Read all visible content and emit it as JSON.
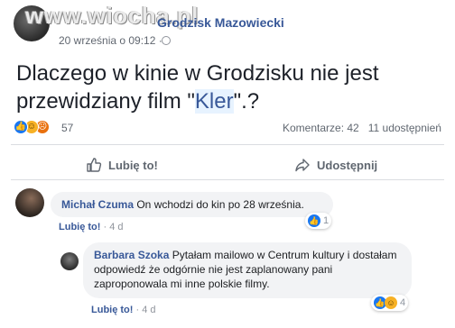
{
  "header": {
    "watermark": "www.wiocha.pl",
    "group_name": "Grodzisk Mazowiecki",
    "time": "20 września o 09:12 ·"
  },
  "post": {
    "text_before": "Dlaczego w kinie w Grodzisku nie jest przewidziany film \"",
    "text_highlight": "Kler",
    "text_after": "\".?"
  },
  "reactions": {
    "icons": [
      "like-icon",
      "haha-icon",
      "angry-icon"
    ],
    "count": "57",
    "comments": "Komentarze: 42",
    "shares": "11 udostępnień"
  },
  "actions": {
    "like": "Lubię to!",
    "share": "Udostępnij"
  },
  "comments": [
    {
      "author": "Michał Czuma",
      "text": " On wchodzi do kin po 28 września.",
      "like_label": "Lubię to!",
      "time": " · 4 d",
      "reaction_count": "1"
    },
    {
      "author": "Barbara Szoka",
      "text": " Pytałam mailowo w Centrum kultury i dostałam odpowiedź że odgórnie nie jest zaplanowany pani zaproponowala mi inne polskie filmy.",
      "like_label": "Lubię to!",
      "time": " · 4 d",
      "reaction_count": "4"
    }
  ],
  "colors": {
    "link": "#385898",
    "like_blue": "#1877f2",
    "bubble": "#f2f3f5"
  }
}
